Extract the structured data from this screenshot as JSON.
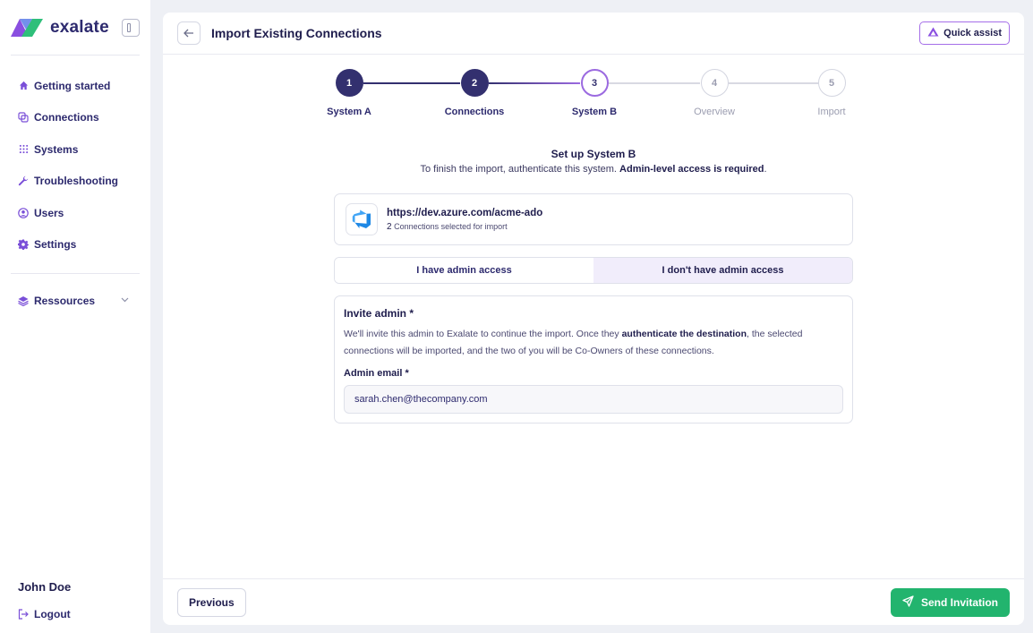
{
  "app": {
    "brand": "exalate"
  },
  "sidebar": {
    "items": [
      {
        "label": "Getting started",
        "icon": "home-icon"
      },
      {
        "label": "Connections",
        "icon": "connections-icon"
      },
      {
        "label": "Systems",
        "icon": "grid-icon"
      },
      {
        "label": "Troubleshooting",
        "icon": "wrench-icon"
      },
      {
        "label": "Users",
        "icon": "user-circle-icon"
      },
      {
        "label": "Settings",
        "icon": "gear-icon"
      }
    ],
    "resources": {
      "label": "Ressources",
      "icon": "layers-icon"
    },
    "user_name": "John Doe",
    "logout_label": "Logout"
  },
  "header": {
    "title": "Import Existing Connections",
    "quick_assist_label": "Quick assist"
  },
  "stepper": {
    "steps": [
      {
        "number": "1",
        "label": "System A",
        "state": "done"
      },
      {
        "number": "2",
        "label": "Connections",
        "state": "done"
      },
      {
        "number": "3",
        "label": "System B",
        "state": "active"
      },
      {
        "number": "4",
        "label": "Overview",
        "state": "pending"
      },
      {
        "number": "5",
        "label": "Import",
        "state": "pending"
      }
    ]
  },
  "setup": {
    "title": "Set up System B",
    "desc_prefix": "To finish the import, authenticate this system.",
    "desc_bold": "Admin-level access is required",
    "desc_suffix": "."
  },
  "system": {
    "url": "https://dev.azure.com/acme-ado",
    "count": "2",
    "count_label": "Connections selected for import"
  },
  "access_toggle": {
    "option_admin": "I have admin access",
    "option_no_admin": "I don't have admin access",
    "selected": "option_no_admin"
  },
  "invite": {
    "title": "Invite admin *",
    "desc_1": "We'll invite this admin to Exalate to continue the import. Once they",
    "desc_bold": "authenticate the destination",
    "desc_2": ", the selected connections will be imported, and the two of you will be Co-Owners of these connections.",
    "email_label": "Admin email *",
    "email_value": "sarah.chen@thecompany.com"
  },
  "footer": {
    "previous_label": "Previous",
    "send_label": "Send Invitation"
  },
  "colors": {
    "primary": "#33306f",
    "accent": "#9b6ae0",
    "success": "#22b46e"
  }
}
